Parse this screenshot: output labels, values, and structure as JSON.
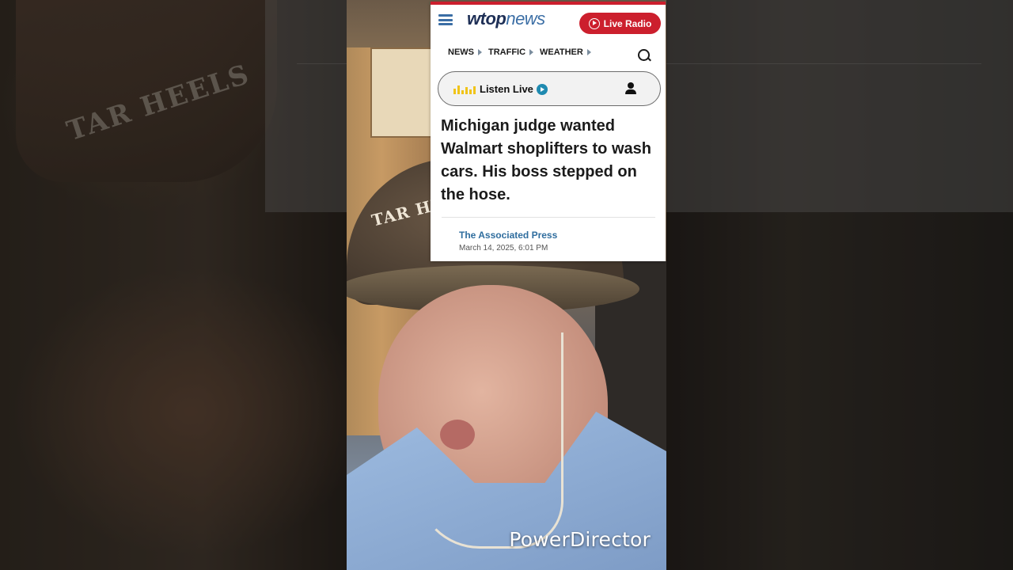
{
  "header": {
    "logo_main": "wtop",
    "logo_sub": "news",
    "live_radio_label": "Live Radio"
  },
  "nav": {
    "items": [
      {
        "label": "NEWS"
      },
      {
        "label": "TRAFFIC"
      },
      {
        "label": "WEATHER"
      }
    ]
  },
  "listen_bar": {
    "label": "Listen Live"
  },
  "article": {
    "headline": "Michigan judge wanted Walmart shoplifters to wash cars. His boss stepped on the hose.",
    "author": "The Associated Press",
    "date": "March 14, 2025, 6:01 PM"
  },
  "video": {
    "watermark": "PowerDirector",
    "hat_text": "TAR HEELS"
  },
  "colors": {
    "brand_red": "#cc1f2d",
    "brand_blue": "#3b6ea5",
    "logo_navy": "#1e2f56",
    "eq_yellow": "#f0c419",
    "play_teal": "#1f8ab0",
    "byline_blue": "#2f6d9e"
  },
  "icons": [
    "menu-icon",
    "play-circle-icon",
    "search-icon",
    "equalizer-icon",
    "play-icon",
    "user-icon"
  ]
}
